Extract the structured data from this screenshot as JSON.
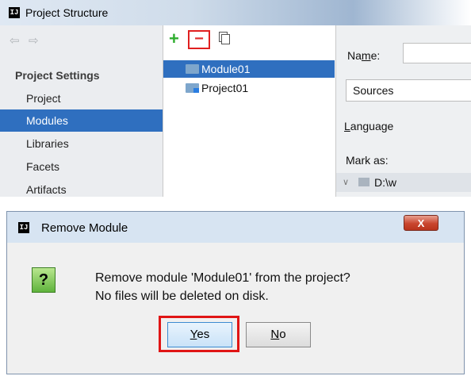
{
  "project_structure": {
    "logo": "IJ",
    "title": "Project Structure",
    "back_arrow": "⇦",
    "forward_arrow": "⇨",
    "section_title": "Project Settings",
    "nav_items": [
      "Project",
      "Modules",
      "Libraries",
      "Facets",
      "Artifacts"
    ],
    "selected_nav": "Modules",
    "toolbar": {
      "add_glyph": "+",
      "remove_glyph": "−"
    },
    "modules": [
      "Module01",
      "Project01"
    ],
    "selected_module": "Module01",
    "right_pane": {
      "name_label": "Name:",
      "sources_tab": "Sources",
      "language_label": "Language",
      "mark_as_label": "Mark as:",
      "path_text": "D:\\w"
    }
  },
  "dialog": {
    "logo": "IJ",
    "title": "Remove Module",
    "close_glyph": "X",
    "icon": "question-icon",
    "question_glyph": "?",
    "message_line1": "Remove module 'Module01' from the project?",
    "message_line2": "No files will be deleted on disk.",
    "yes_mnemonic": "Y",
    "yes_rest": "es",
    "no_mnemonic": "N",
    "no_rest": "o",
    "highlight_color": "#e01515"
  }
}
